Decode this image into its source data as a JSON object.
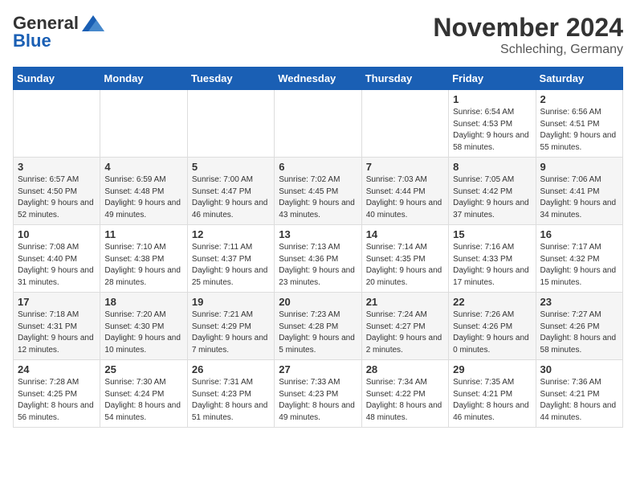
{
  "header": {
    "logo_general": "General",
    "logo_blue": "Blue",
    "month_title": "November 2024",
    "location": "Schleching, Germany"
  },
  "weekdays": [
    "Sunday",
    "Monday",
    "Tuesday",
    "Wednesday",
    "Thursday",
    "Friday",
    "Saturday"
  ],
  "weeks": [
    [
      {
        "day": "",
        "info": ""
      },
      {
        "day": "",
        "info": ""
      },
      {
        "day": "",
        "info": ""
      },
      {
        "day": "",
        "info": ""
      },
      {
        "day": "",
        "info": ""
      },
      {
        "day": "1",
        "info": "Sunrise: 6:54 AM\nSunset: 4:53 PM\nDaylight: 9 hours and 58 minutes."
      },
      {
        "day": "2",
        "info": "Sunrise: 6:56 AM\nSunset: 4:51 PM\nDaylight: 9 hours and 55 minutes."
      }
    ],
    [
      {
        "day": "3",
        "info": "Sunrise: 6:57 AM\nSunset: 4:50 PM\nDaylight: 9 hours and 52 minutes."
      },
      {
        "day": "4",
        "info": "Sunrise: 6:59 AM\nSunset: 4:48 PM\nDaylight: 9 hours and 49 minutes."
      },
      {
        "day": "5",
        "info": "Sunrise: 7:00 AM\nSunset: 4:47 PM\nDaylight: 9 hours and 46 minutes."
      },
      {
        "day": "6",
        "info": "Sunrise: 7:02 AM\nSunset: 4:45 PM\nDaylight: 9 hours and 43 minutes."
      },
      {
        "day": "7",
        "info": "Sunrise: 7:03 AM\nSunset: 4:44 PM\nDaylight: 9 hours and 40 minutes."
      },
      {
        "day": "8",
        "info": "Sunrise: 7:05 AM\nSunset: 4:42 PM\nDaylight: 9 hours and 37 minutes."
      },
      {
        "day": "9",
        "info": "Sunrise: 7:06 AM\nSunset: 4:41 PM\nDaylight: 9 hours and 34 minutes."
      }
    ],
    [
      {
        "day": "10",
        "info": "Sunrise: 7:08 AM\nSunset: 4:40 PM\nDaylight: 9 hours and 31 minutes."
      },
      {
        "day": "11",
        "info": "Sunrise: 7:10 AM\nSunset: 4:38 PM\nDaylight: 9 hours and 28 minutes."
      },
      {
        "day": "12",
        "info": "Sunrise: 7:11 AM\nSunset: 4:37 PM\nDaylight: 9 hours and 25 minutes."
      },
      {
        "day": "13",
        "info": "Sunrise: 7:13 AM\nSunset: 4:36 PM\nDaylight: 9 hours and 23 minutes."
      },
      {
        "day": "14",
        "info": "Sunrise: 7:14 AM\nSunset: 4:35 PM\nDaylight: 9 hours and 20 minutes."
      },
      {
        "day": "15",
        "info": "Sunrise: 7:16 AM\nSunset: 4:33 PM\nDaylight: 9 hours and 17 minutes."
      },
      {
        "day": "16",
        "info": "Sunrise: 7:17 AM\nSunset: 4:32 PM\nDaylight: 9 hours and 15 minutes."
      }
    ],
    [
      {
        "day": "17",
        "info": "Sunrise: 7:18 AM\nSunset: 4:31 PM\nDaylight: 9 hours and 12 minutes."
      },
      {
        "day": "18",
        "info": "Sunrise: 7:20 AM\nSunset: 4:30 PM\nDaylight: 9 hours and 10 minutes."
      },
      {
        "day": "19",
        "info": "Sunrise: 7:21 AM\nSunset: 4:29 PM\nDaylight: 9 hours and 7 minutes."
      },
      {
        "day": "20",
        "info": "Sunrise: 7:23 AM\nSunset: 4:28 PM\nDaylight: 9 hours and 5 minutes."
      },
      {
        "day": "21",
        "info": "Sunrise: 7:24 AM\nSunset: 4:27 PM\nDaylight: 9 hours and 2 minutes."
      },
      {
        "day": "22",
        "info": "Sunrise: 7:26 AM\nSunset: 4:26 PM\nDaylight: 9 hours and 0 minutes."
      },
      {
        "day": "23",
        "info": "Sunrise: 7:27 AM\nSunset: 4:26 PM\nDaylight: 8 hours and 58 minutes."
      }
    ],
    [
      {
        "day": "24",
        "info": "Sunrise: 7:28 AM\nSunset: 4:25 PM\nDaylight: 8 hours and 56 minutes."
      },
      {
        "day": "25",
        "info": "Sunrise: 7:30 AM\nSunset: 4:24 PM\nDaylight: 8 hours and 54 minutes."
      },
      {
        "day": "26",
        "info": "Sunrise: 7:31 AM\nSunset: 4:23 PM\nDaylight: 8 hours and 51 minutes."
      },
      {
        "day": "27",
        "info": "Sunrise: 7:33 AM\nSunset: 4:23 PM\nDaylight: 8 hours and 49 minutes."
      },
      {
        "day": "28",
        "info": "Sunrise: 7:34 AM\nSunset: 4:22 PM\nDaylight: 8 hours and 48 minutes."
      },
      {
        "day": "29",
        "info": "Sunrise: 7:35 AM\nSunset: 4:21 PM\nDaylight: 8 hours and 46 minutes."
      },
      {
        "day": "30",
        "info": "Sunrise: 7:36 AM\nSunset: 4:21 PM\nDaylight: 8 hours and 44 minutes."
      }
    ]
  ]
}
